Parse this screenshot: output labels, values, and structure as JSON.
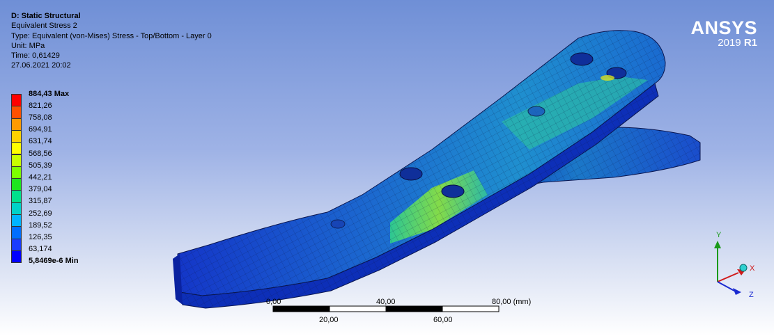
{
  "header": {
    "system_title": "D: Static Structural",
    "result_name": "Equivalent Stress 2",
    "type_line": "Type: Equivalent (von-Mises) Stress - Top/Bottom - Layer 0",
    "unit_line": "Unit: MPa",
    "time_line": "Time: 0,61429",
    "date_line": "27.06.2021 20:02"
  },
  "legend": {
    "max_label": "884,43 Max",
    "min_label": "5,8469e-6 Min",
    "levels": [
      "821,26",
      "758,08",
      "694,91",
      "631,74",
      "568,56",
      "505,39",
      "442,21",
      "379,04",
      "315,87",
      "252,69",
      "189,52",
      "126,35",
      "63,174"
    ],
    "colors": [
      "#ff0000",
      "#ff5000",
      "#ff9a00",
      "#ffd200",
      "#ffff00",
      "#c8ff00",
      "#7dff00",
      "#1ee61e",
      "#00e18c",
      "#00d2c8",
      "#00b4ff",
      "#006eff",
      "#1a3cff",
      "#0000ff"
    ]
  },
  "logo": {
    "brand": "ANSYS",
    "version_year": "2019",
    "version_rel": "R1"
  },
  "scale_bar": {
    "top_labels": [
      "0,00",
      "40,00",
      "80,00 (mm)"
    ],
    "bottom_labels": [
      "20,00",
      "60,00"
    ]
  },
  "triad": {
    "x": "X",
    "y": "Y",
    "z": "Z"
  }
}
